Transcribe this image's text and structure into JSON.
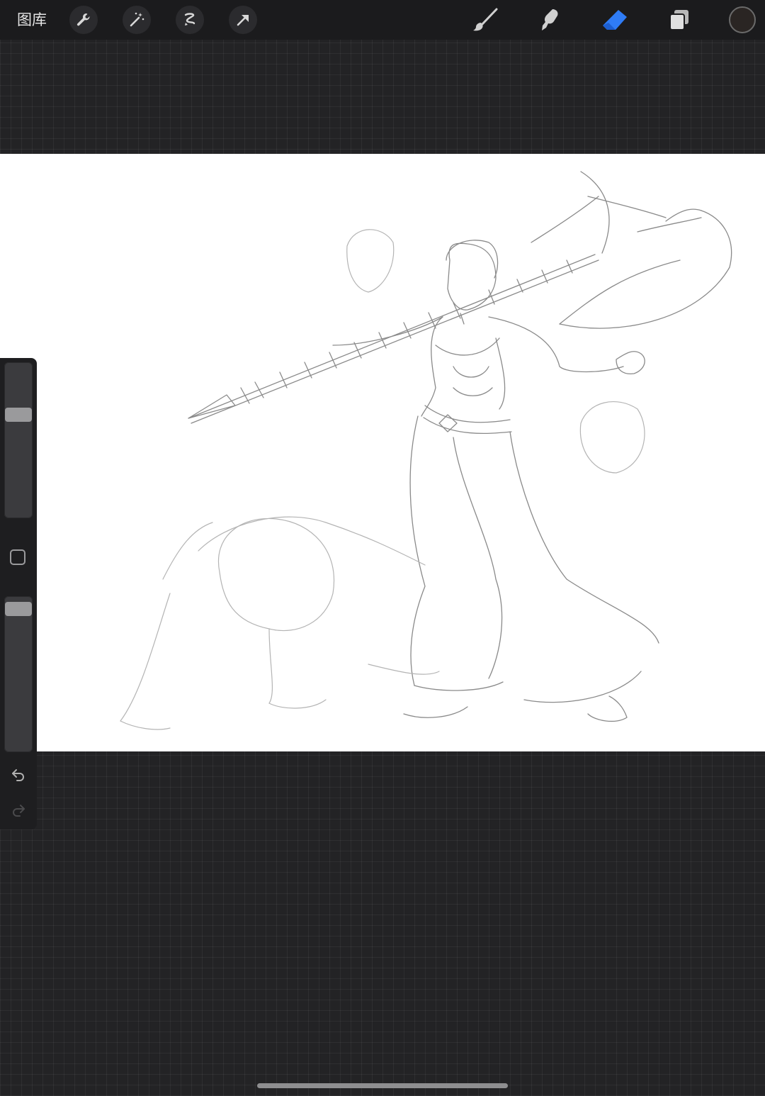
{
  "topbar": {
    "gallery_label": "图库",
    "left_tools": [
      "wrench-icon",
      "magic-wand-icon",
      "selection-icon",
      "transform-arrow-icon"
    ],
    "right_tools": [
      "brush-icon",
      "smudge-icon",
      "eraser-icon",
      "layers-icon"
    ],
    "active_tool": "eraser",
    "active_tool_color": "#2f7cf6",
    "current_color": "#2a2523"
  },
  "sidebar": {
    "brush_size_level": 0.68,
    "opacity_level": 0.96,
    "buttons": [
      "modify-square-icon",
      "undo-icon",
      "redo-icon"
    ]
  }
}
